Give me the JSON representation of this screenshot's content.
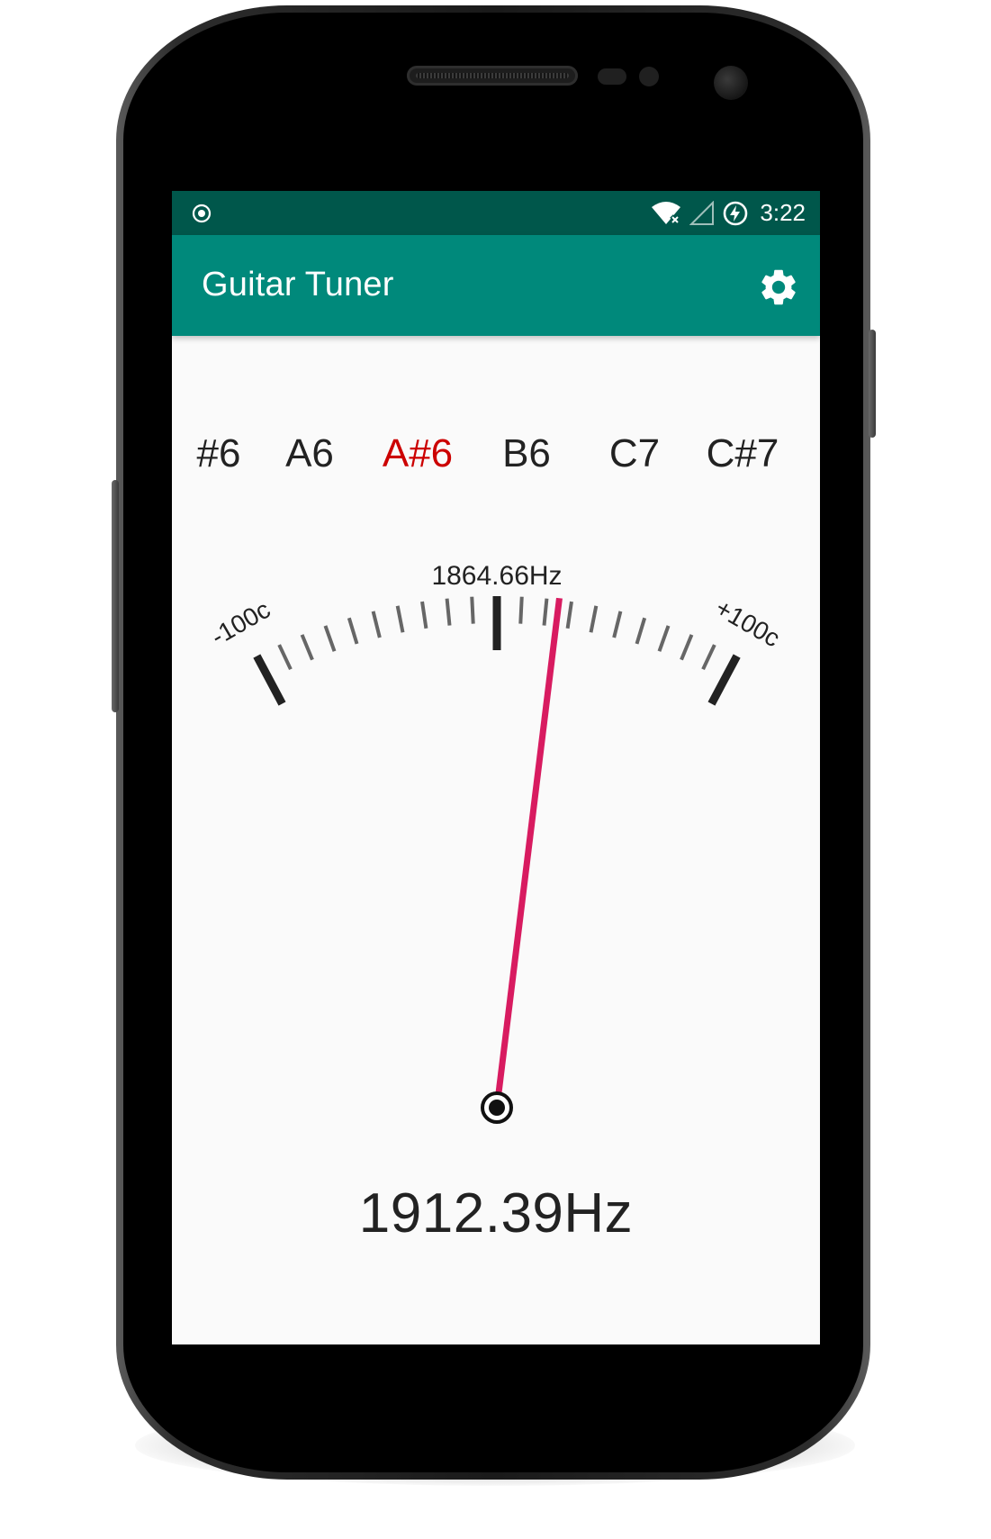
{
  "status_bar": {
    "time": "3:22",
    "icons": [
      "radio-button-icon",
      "wifi-off-icon",
      "cell-signal-icon",
      "battery-charging-icon"
    ]
  },
  "app_bar": {
    "title": "Guitar Tuner",
    "settings_icon": "gear-icon"
  },
  "notes": {
    "items": [
      "#6",
      "A6",
      "A#6",
      "B6",
      "C7",
      "C#7"
    ],
    "active": "A#6"
  },
  "dial": {
    "target_frequency": "1864.66Hz",
    "min_label": "-100c",
    "max_label": "+100c",
    "needle_color": "#d81b60",
    "needle_cents": 25
  },
  "readout": {
    "frequency": "1912.39Hz"
  },
  "colors": {
    "status_bar": "#00574b",
    "app_bar": "#00897b",
    "active_note": "#cc0000"
  }
}
